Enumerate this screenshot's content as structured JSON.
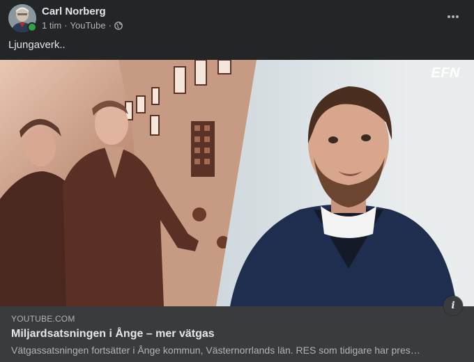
{
  "post": {
    "author": "Carl Norberg",
    "time": "1 tim",
    "source": "YouTube",
    "separator": "·",
    "audience_icon": "globe-icon",
    "text": "Ljungaverk..",
    "more_icon": "more-horizontal-icon"
  },
  "media": {
    "watermark": "EFN"
  },
  "link_preview": {
    "domain": "YOUTUBE.COM",
    "title": "Miljardsatsningen i Ånge – mer vätgas",
    "description": "Vätgassatsningen fortsätter i Ånge kommun, Västernorrlands län. RES som tidigare har pres…",
    "info_icon": "info-icon"
  },
  "colors": {
    "background": "#242526",
    "preview_background": "#3a3b3c",
    "online": "#31a24c",
    "primary_text": "#e4e6eb",
    "secondary_text": "#b0b3b8"
  }
}
